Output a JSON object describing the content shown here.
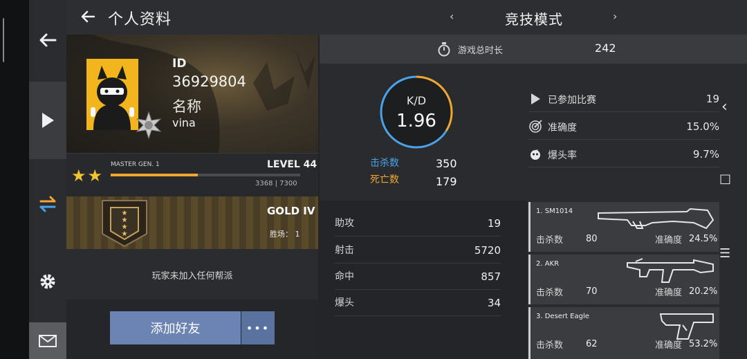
{
  "header": {
    "title": "个人资料",
    "mode_prev": "‹",
    "mode_title": "竞技模式",
    "mode_next": "›"
  },
  "profile": {
    "id_label": "ID",
    "id_value": "36929804",
    "name_label": "名称",
    "name_value": "vina"
  },
  "level": {
    "title": "MASTER GEN. 1",
    "level_label": "LEVEL 44",
    "xp": "3368 | 7300",
    "progress": 0.461,
    "stars": "★★"
  },
  "rank": {
    "name": "GOLD IV",
    "wins": "胜场：  1"
  },
  "clan": {
    "text": "玩家未加入任何帮派"
  },
  "actions": {
    "add_friend": "添加好友",
    "more": "•••"
  },
  "playtime": {
    "label": "游戏总时长",
    "value": "242"
  },
  "kd": {
    "label": "K/D",
    "value": "1.96",
    "kills_label": "击杀数",
    "kills_value": "350",
    "deaths_label": "死亡数",
    "deaths_value": "179",
    "kill_share": 0.662
  },
  "side_stats": [
    {
      "icon": "play-icon",
      "label": "已参加比赛",
      "value": "19"
    },
    {
      "icon": "target-icon",
      "label": "准确度",
      "value": "15.0%"
    },
    {
      "icon": "headshot-icon",
      "label": "爆头率",
      "value": "9.7%"
    }
  ],
  "bottom_stats": [
    {
      "label": "助攻",
      "value": "19"
    },
    {
      "label": "射击",
      "value": "5720"
    },
    {
      "label": "命中",
      "value": "857"
    },
    {
      "label": "爆头",
      "value": "34"
    }
  ],
  "weapons": [
    {
      "name": "1. SM1014",
      "kills_label": "击杀数",
      "kills": "80",
      "acc_label": "准确度",
      "acc": "24.5%",
      "gun": "shotgun-icon"
    },
    {
      "name": "2. AKR",
      "kills_label": "击杀数",
      "kills": "70",
      "acc_label": "准确度",
      "acc": "20.2%",
      "gun": "rifle-icon"
    },
    {
      "name": "3. Desert Eagle",
      "kills_label": "击杀数",
      "kills": "62",
      "acc_label": "准确度",
      "acc": "53.2%",
      "gun": "pistol-icon"
    }
  ],
  "system_nav": {
    "back": "‹",
    "recent": "□",
    "menu": "☰"
  },
  "colors": {
    "accent_blue": "#4aa3e8",
    "accent_orange": "#f0a830",
    "button_blue": "#6b84b3"
  }
}
